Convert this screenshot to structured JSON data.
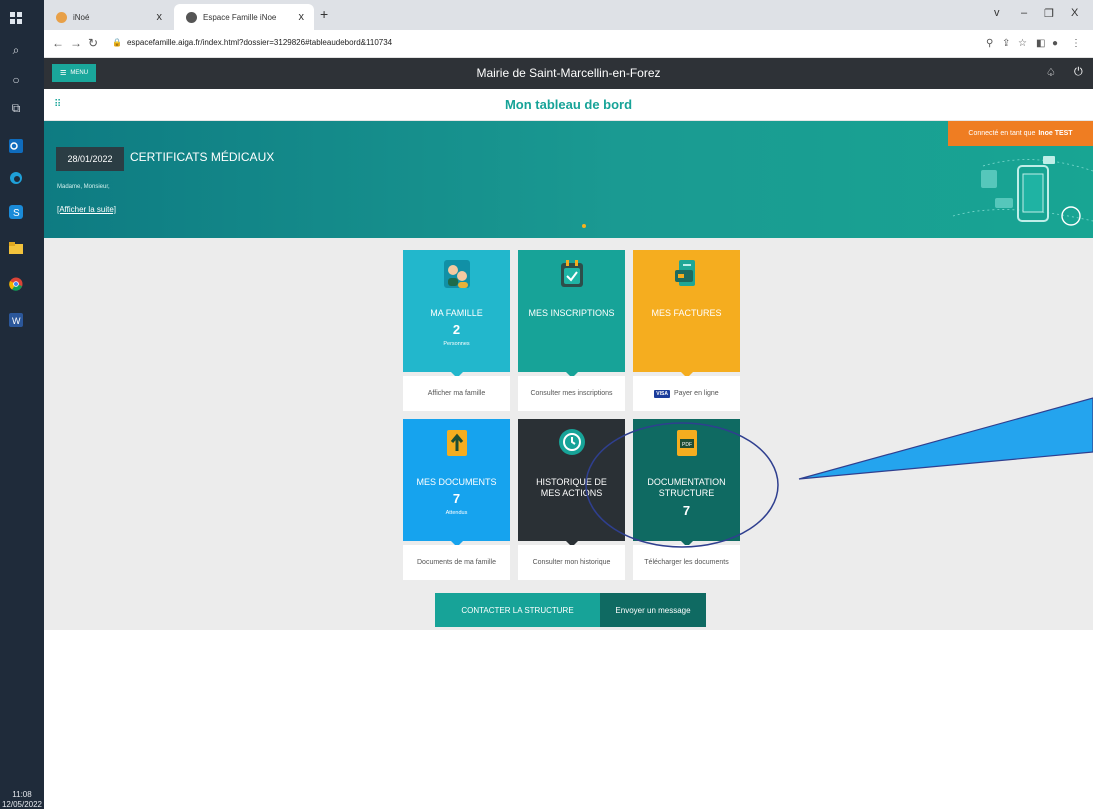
{
  "taskbar": {
    "clock_time": "11:08",
    "clock_date": "12/05/2022"
  },
  "browser": {
    "tabs": [
      {
        "title": "iNoé"
      },
      {
        "title": "Espace Famille iNoe"
      }
    ],
    "url": "espacefamille.aiga.fr/index.html?dossier=3129826#tableaudebord&110734"
  },
  "app": {
    "menu_label": "MENU",
    "title": "Mairie de Saint-Marcellin-en-Forez",
    "page_title": "Mon tableau de bord"
  },
  "banner": {
    "date": "28/01/2022",
    "title": "CERTIFICATS MÉDICAUX",
    "body": "Madame, Monsieur,",
    "link": "[Afficher la suite]",
    "connected_prefix": "Connecté en tant que",
    "connected_user": "Inoe TEST"
  },
  "tiles": {
    "famille": {
      "label": "MA FAMILLE",
      "count": "2",
      "sub": "Personnes",
      "footer": "Afficher ma famille",
      "color": "#22b7cc"
    },
    "inscriptions": {
      "label": "MES INSCRIPTIONS",
      "footer": "Consulter mes inscriptions",
      "color": "#17a398"
    },
    "factures": {
      "label": "MES FACTURES",
      "footer": "Payer en ligne",
      "visa": "VISA",
      "color": "#f5ad1f"
    },
    "documents": {
      "label": "MES DOCUMENTS",
      "count": "7",
      "sub": "Attendus",
      "footer": "Documents de ma famille",
      "color": "#16a3ee"
    },
    "historique": {
      "label_line1": "HISTORIQUE DE",
      "label_line2": "MES ACTIONS",
      "footer": "Consulter mon historique",
      "color": "#2a3035"
    },
    "documentation": {
      "label_line1": "DOCUMENTATION",
      "label_line2": "STRUCTURE",
      "count": "7",
      "footer": "Télécharger les documents",
      "color": "#0f6a62"
    }
  },
  "actions": {
    "contact": "CONTACTER LA STRUCTURE",
    "message": "Envoyer un message"
  }
}
